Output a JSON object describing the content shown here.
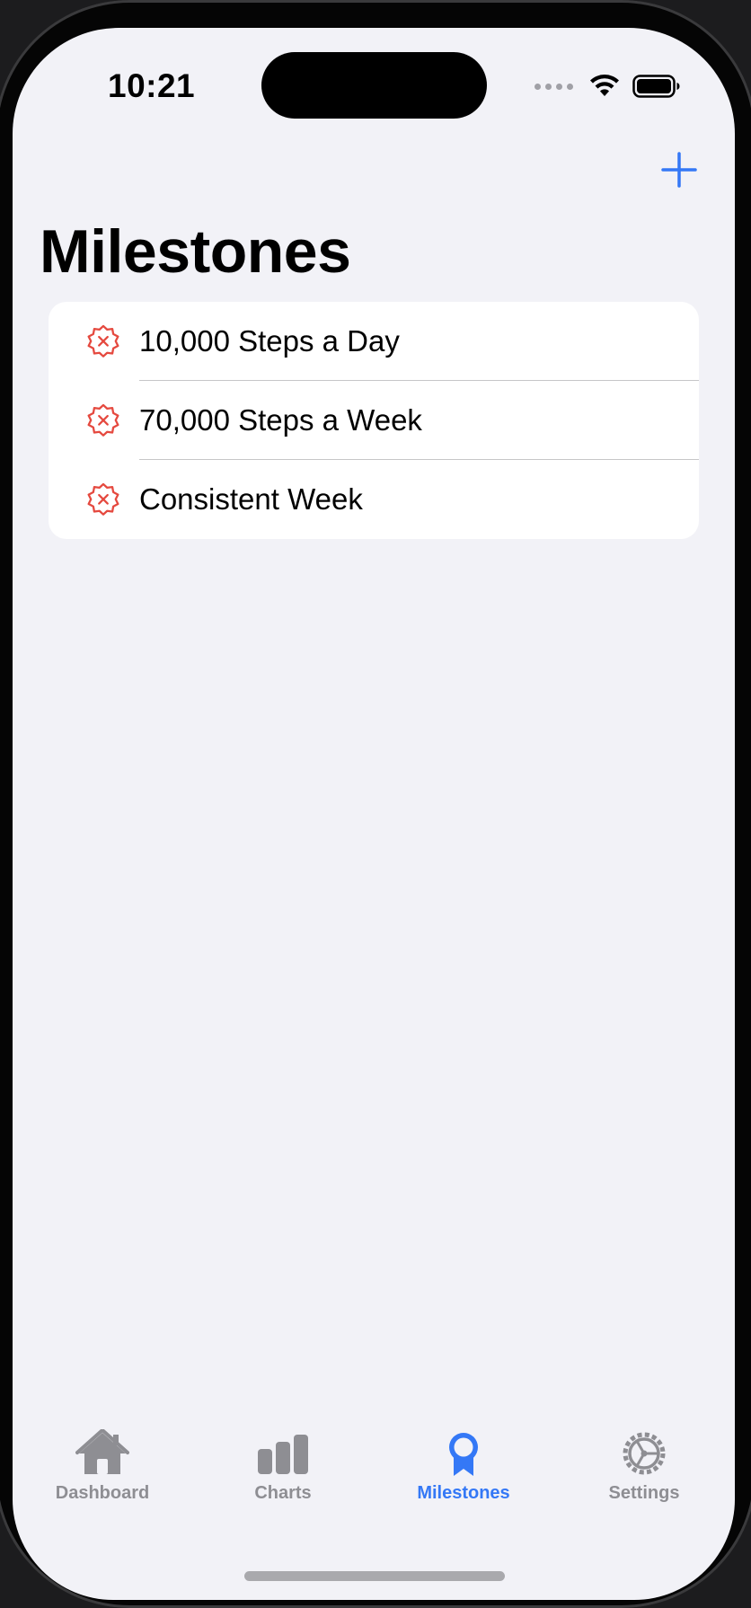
{
  "status_bar": {
    "time": "10:21"
  },
  "nav": {
    "add_icon": "plus-icon",
    "title": "Milestones"
  },
  "milestones": [
    {
      "label": "10,000 Steps a Day",
      "icon": "xmark-seal-icon"
    },
    {
      "label": "70,000 Steps a Week",
      "icon": "xmark-seal-icon"
    },
    {
      "label": "Consistent Week",
      "icon": "xmark-seal-icon"
    }
  ],
  "tab_bar": {
    "tabs": [
      {
        "label": "Dashboard",
        "icon": "house-icon",
        "selected": false
      },
      {
        "label": "Charts",
        "icon": "chart-bar-icon",
        "selected": false
      },
      {
        "label": "Milestones",
        "icon": "medal-icon",
        "selected": true
      },
      {
        "label": "Settings",
        "icon": "gear-icon",
        "selected": false
      }
    ]
  },
  "colors": {
    "accent": "#3478f6",
    "failed": "#e5493f",
    "inactive": "#8e8e93",
    "background": "#f2f2f7"
  }
}
